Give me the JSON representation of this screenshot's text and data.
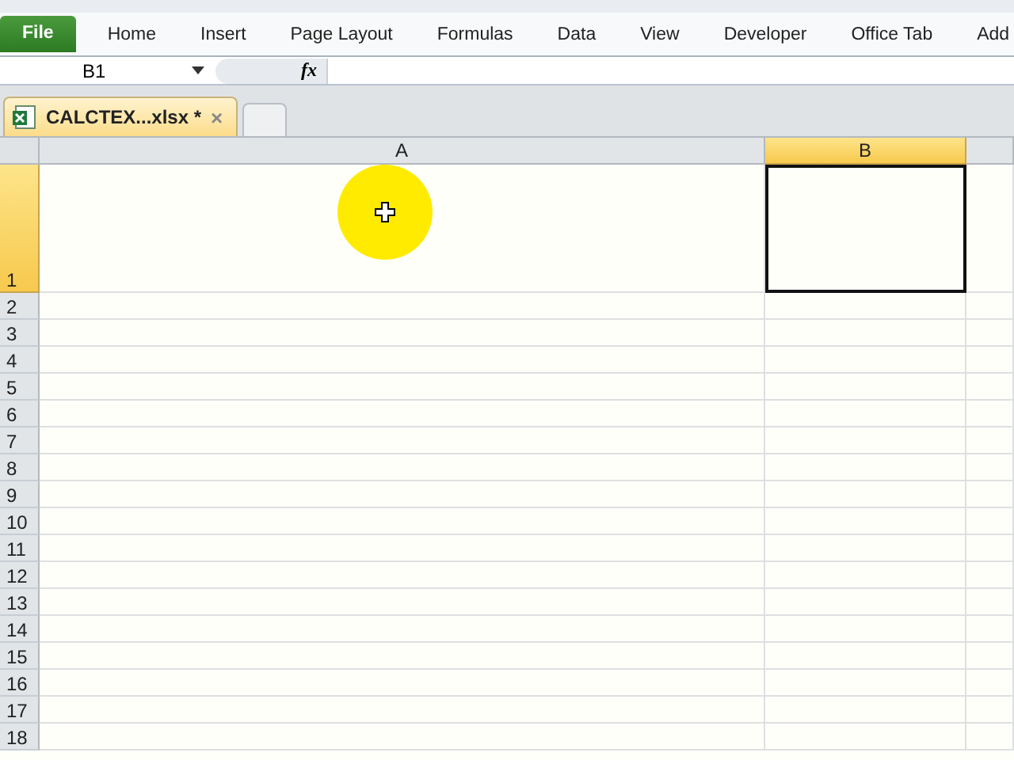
{
  "ribbon_tabs": [
    {
      "label": "File",
      "kind": "file"
    },
    {
      "label": "Home",
      "kind": "tab"
    },
    {
      "label": "Insert",
      "kind": "tab"
    },
    {
      "label": "Page Layout",
      "kind": "tab"
    },
    {
      "label": "Formulas",
      "kind": "tab"
    },
    {
      "label": "Data",
      "kind": "tab"
    },
    {
      "label": "View",
      "kind": "tab"
    },
    {
      "label": "Developer",
      "kind": "tab"
    },
    {
      "label": "Office Tab",
      "kind": "tab"
    },
    {
      "label": "Add",
      "kind": "tab"
    }
  ],
  "formula_bar": {
    "name_box": "B1",
    "fx": "fx"
  },
  "document_tabs": [
    {
      "label": "CALCTEX...xlsx *",
      "close": "×",
      "selected": true
    }
  ],
  "columns": [
    {
      "label": "A",
      "selected": false
    },
    {
      "label": "B",
      "selected": true
    }
  ],
  "rows": [
    {
      "label": "1",
      "selected": true
    },
    {
      "label": "2",
      "selected": false
    },
    {
      "label": "3",
      "selected": false
    },
    {
      "label": "4",
      "selected": false
    },
    {
      "label": "5",
      "selected": false
    },
    {
      "label": "6",
      "selected": false
    },
    {
      "label": "7",
      "selected": false
    },
    {
      "label": "8",
      "selected": false
    },
    {
      "label": "9",
      "selected": false
    },
    {
      "label": "10",
      "selected": false
    },
    {
      "label": "11",
      "selected": false
    },
    {
      "label": "12",
      "selected": false
    },
    {
      "label": "13",
      "selected": false
    },
    {
      "label": "14",
      "selected": false
    },
    {
      "label": "15",
      "selected": false
    },
    {
      "label": "16",
      "selected": false
    },
    {
      "label": "17",
      "selected": false
    },
    {
      "label": "18",
      "selected": false
    }
  ]
}
